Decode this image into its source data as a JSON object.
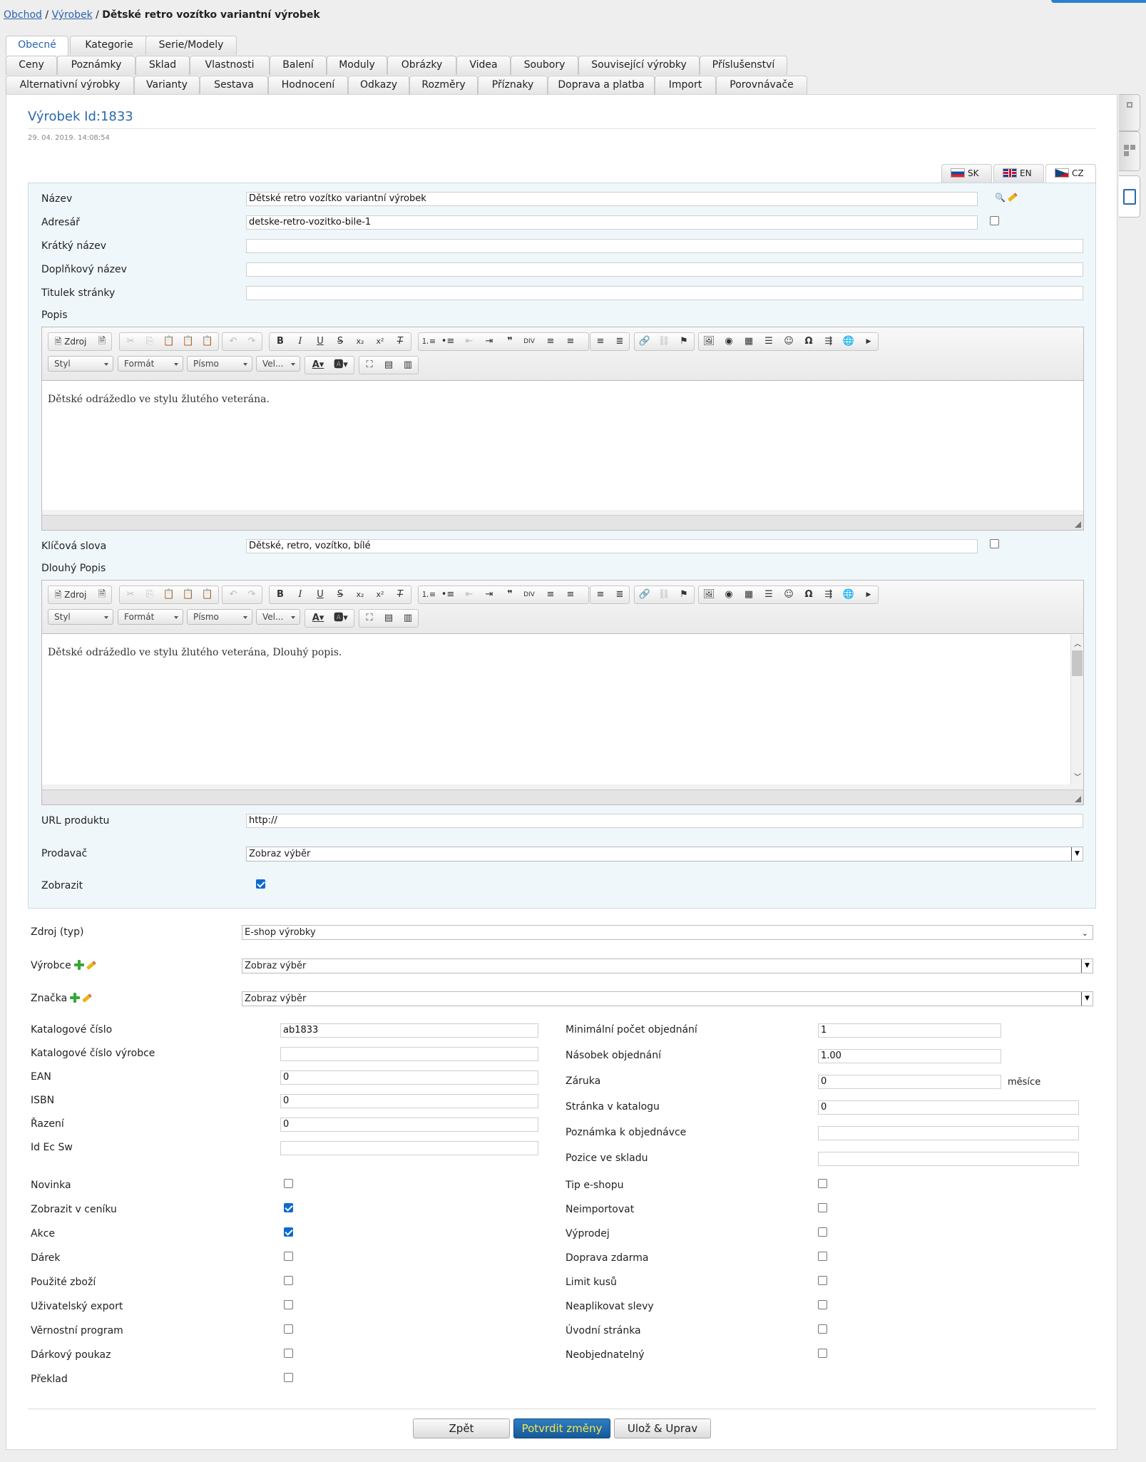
{
  "breadcrumb": {
    "shop": "Obchod",
    "products": "Výrobek",
    "current": "Dětské retro vozítko variantní výrobek",
    "sep": "/"
  },
  "tabs": {
    "row1": [
      "Obecné",
      "Kategorie",
      "Serie/Modely"
    ],
    "row2": [
      "Ceny",
      "Poznámky",
      "Sklad",
      "Vlastnosti",
      "Balení",
      "Moduly",
      "Obrázky",
      "Videa",
      "Soubory",
      "Související výrobky",
      "Příslušenství"
    ],
    "row3": [
      "Alternativní výrobky",
      "Varianty",
      "Sestava",
      "Hodnocení",
      "Odkazy",
      "Rozměry",
      "Příznaky",
      "Doprava a platba",
      "Import",
      "Porovnávače"
    ]
  },
  "product": {
    "title": "Výrobek Id:1833",
    "date": "29. 04. 2019. 14:08:54"
  },
  "languages": [
    "SK",
    "EN",
    "CZ"
  ],
  "form": {
    "name_label": "Název",
    "name_value": "Dětské retro vozítko variantní výrobek",
    "addr_label": "Adresář",
    "addr_value": "detske-retro-vozitko-bile-1",
    "short_label": "Krátký název",
    "extra_label": "Doplňkový název",
    "pagetitle_label": "Titulek stránky",
    "desc_label": "Popis",
    "desc_text": "Dětské odrážedlo ve stylu žlutého veterána.",
    "keywords_label": "Klíčová slova",
    "keywords_value": "Dětské, retro, vozítko, bílé",
    "longdesc_label": "Dlouhý Popis",
    "longdesc_text": "Dětské odrážedlo ve stylu žlutého veterána, Dlouhý popis.",
    "url_label": "URL produktu",
    "url_value": "http://",
    "seller_label": "Prodavač",
    "seller_value": "Zobraz výběr",
    "show_label": "Zobrazit"
  },
  "editor": {
    "source": "Zdroj",
    "style": "Styl",
    "format": "Formát",
    "font": "Písmo",
    "size": "Vel..."
  },
  "general": {
    "source_type_label": "Zdroj (typ)",
    "source_type_value": "E-shop výrobky",
    "maker_label": "Výrobce",
    "maker_value": "Zobraz výběr",
    "brand_label": "Značka",
    "brand_value": "Zobraz výběr",
    "left_fields": [
      {
        "label": "Katalogové číslo",
        "value": "ab1833"
      },
      {
        "label": "Katalogové číslo výrobce",
        "value": ""
      },
      {
        "label": "EAN",
        "value": "0"
      },
      {
        "label": "ISBN",
        "value": "0"
      },
      {
        "label": "Řazení",
        "value": "0"
      },
      {
        "label": "Id Ec Sw",
        "value": ""
      }
    ],
    "right_fields": [
      {
        "label": "Minimální počet objednání",
        "value": "1"
      },
      {
        "label": "Násobek objednání",
        "value": "1.00"
      },
      {
        "label": "Záruka",
        "value": "0",
        "unit": "měsíce"
      },
      {
        "label": "Stránka v katalogu",
        "value": "0"
      },
      {
        "label": "Poznámka k objednávce",
        "value": ""
      },
      {
        "label": "Pozice ve skladu",
        "value": ""
      }
    ],
    "left_checks": [
      {
        "label": "Novinka",
        "checked": false
      },
      {
        "label": "Zobrazit v ceníku",
        "checked": true
      },
      {
        "label": "Akce",
        "checked": true
      },
      {
        "label": "Dárek",
        "checked": false
      },
      {
        "label": "Použité zboží",
        "checked": false
      },
      {
        "label": "Uživatelský export",
        "checked": false
      },
      {
        "label": "Věrnostní program",
        "checked": false
      },
      {
        "label": "Dárkový poukaz",
        "checked": false
      },
      {
        "label": "Překlad",
        "checked": false
      }
    ],
    "right_checks": [
      {
        "label": "Tip e-shopu",
        "checked": false
      },
      {
        "label": "Neimportovat",
        "checked": false
      },
      {
        "label": "Výprodej",
        "checked": false
      },
      {
        "label": "Doprava zdarma",
        "checked": false
      },
      {
        "label": "Limit kusů",
        "checked": false
      },
      {
        "label": "Neaplikovat slevy",
        "checked": false
      },
      {
        "label": "Úvodní stránka",
        "checked": false
      },
      {
        "label": "Neobjednatelný",
        "checked": false
      }
    ]
  },
  "footer": {
    "back": "Zpět",
    "confirm": "Potvrdit změny",
    "save_edit": "Ulož & Uprav"
  },
  "colors": {
    "accent": "#2a6aa8",
    "link": "#2a63b0",
    "primary_btn": "#1d67a8",
    "primary_btn_text": "#f7e64a",
    "check": "#0e6ad1"
  }
}
